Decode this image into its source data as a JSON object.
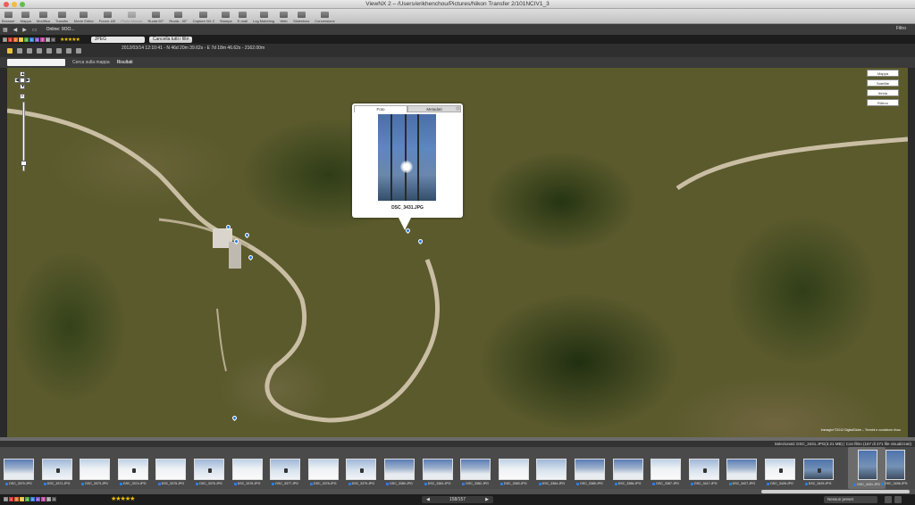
{
  "window": {
    "title": "ViewNX 2 – /Users/erikhenchou/Pictures/Nikon Transfer 2/101NCIV1_3"
  },
  "toolbar": {
    "buttons": [
      {
        "id": "browser",
        "label": "Browser",
        "disabled": false
      },
      {
        "id": "mappa",
        "label": "Mappa",
        "disabled": false
      },
      {
        "id": "modifica",
        "label": "Modifica",
        "disabled": false
      },
      {
        "id": "transfer",
        "label": "Transfer",
        "disabled": false
      },
      {
        "id": "movie",
        "label": "Movie Editor",
        "disabled": false
      },
      {
        "id": "funz",
        "label": "Funzn. AE",
        "disabled": false
      },
      {
        "id": "photo",
        "label": "Photo Mosaic",
        "disabled": true
      },
      {
        "id": "ruota90",
        "label": "Ruota 90°",
        "disabled": false
      },
      {
        "id": "ruota-90",
        "label": "Ruota - 90°",
        "disabled": false
      },
      {
        "id": "capture",
        "label": "Capture NX 2",
        "disabled": false
      },
      {
        "id": "stampa",
        "label": "Stampa",
        "disabled": false
      },
      {
        "id": "email",
        "label": "E-mail",
        "disabled": false
      },
      {
        "id": "logmatching",
        "label": "Log Matching",
        "disabled": false
      },
      {
        "id": "web",
        "label": "Web",
        "disabled": false
      },
      {
        "id": "slideshow",
        "label": "Slideshow",
        "disabled": false
      },
      {
        "id": "conversione",
        "label": "Conversione",
        "disabled": false
      }
    ]
  },
  "navbar": {
    "online_label": "Online: 9OO...",
    "filter_label": "Filtro"
  },
  "filters": {
    "labels": [
      "0",
      "1",
      "2",
      "3",
      "4",
      "5",
      "6",
      "7",
      "8",
      "9"
    ],
    "label_colors": [
      "#888888",
      "#d23a2f",
      "#e86d2c",
      "#e4c238",
      "#4ba63b",
      "#2e7de0",
      "#7a4fc7",
      "#c94fa4",
      "#999999",
      "#555555"
    ],
    "stars": "★★★★★",
    "file_type": "JPEG",
    "clear_button": "Cancella tutti i filtri"
  },
  "gps_info": {
    "line1": "2012/03/14 12:10:41 - N 46d 20m 39.62s - E 7d 18m 46.62s - 2162.00m"
  },
  "map_tabs": {
    "search_label": "Cerca sulla mappa",
    "results_label": "Risultati"
  },
  "map": {
    "types": [
      "Mappa",
      "Satellite",
      "Ibrida",
      "Rilievo"
    ],
    "credit": "Immagini ©2012 DigitalGlobe – Termini e condizioni d'uso",
    "popup": {
      "tabs": [
        "Foto",
        "Metadati"
      ],
      "caption": "DSC_3431.JPG"
    }
  },
  "status": {
    "text": "Selezionati: DSC_3431.JPG(3.21 MB) | Con filtro (157 di 271 file visualizzati)"
  },
  "thumbnails": [
    {
      "name": "DSC_3370.JPG",
      "style": "snow3"
    },
    {
      "name": "DSC_3371.JPG",
      "style": "snow figure"
    },
    {
      "name": "DSC_3373.JPG",
      "style": "snow2"
    },
    {
      "name": "DSC_3374.JPG",
      "style": "snow2 figure"
    },
    {
      "name": "DSC_3375.JPG",
      "style": "snow2"
    },
    {
      "name": "DSC_3376.JPG",
      "style": "snow figure"
    },
    {
      "name": "DSC_3376.JPG",
      "style": "snow2"
    },
    {
      "name": "DSC_3377.JPG",
      "style": "snow figure"
    },
    {
      "name": "DSC_3378.JPG",
      "style": "snow2"
    },
    {
      "name": "DSC_3379.JPG",
      "style": "snow figure"
    },
    {
      "name": "DSC_3380.JPG",
      "style": "snow3"
    },
    {
      "name": "DSC_3381.JPG",
      "style": "snow3"
    },
    {
      "name": "DSC_3382.JPG",
      "style": "snow3"
    },
    {
      "name": "DSC_3383.JPG",
      "style": "snow2"
    },
    {
      "name": "DSC_3384.JPG",
      "style": "snow"
    },
    {
      "name": "DSC_3385.JPG",
      "style": "snow3"
    },
    {
      "name": "DSC_3386.JPG",
      "style": "snow3"
    },
    {
      "name": "DSC_3387.JPG",
      "style": "snow2"
    },
    {
      "name": "DSC_3417.JPG",
      "style": "snow figure"
    },
    {
      "name": "DSC_3427.JPG",
      "style": "snow3"
    },
    {
      "name": "DSC_3428.JPG",
      "style": "snow2 figure"
    },
    {
      "name": "DSC_3429.JPG",
      "style": "forest figure"
    },
    {
      "name": "DSC_3431.JPG",
      "style": "forest",
      "portrait": true,
      "selected": true
    },
    {
      "name": "DSC_3438.JPG",
      "style": "forest",
      "portrait": true
    }
  ],
  "bottombar": {
    "stars": "★★★★★",
    "prev": "◀",
    "next": "▶",
    "page_label": "158/157",
    "preset_label": "Nessun preset"
  }
}
